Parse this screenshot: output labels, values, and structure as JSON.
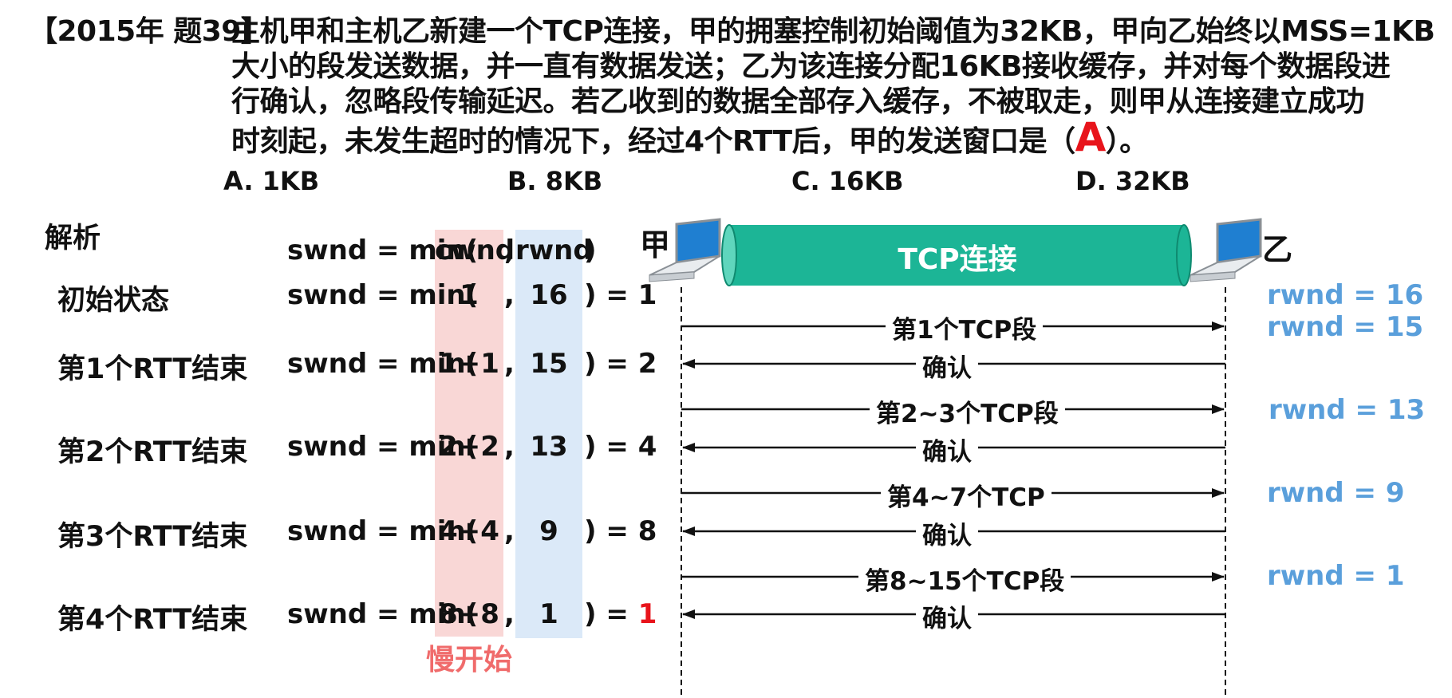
{
  "question": {
    "tag": "【2015年 题39】",
    "lines": [
      "主机甲和主机乙新建一个TCP连接，甲的拥塞控制初始阈值为32KB，甲向乙始终以MSS=1KB",
      "大小的段发送数据，并一直有数据发送；乙为该连接分配16KB接收缓存，并对每个数据段进",
      "行确认，忽略段传输延迟。若乙收到的数据全部存入缓存，不被取走，则甲从连接建立成功",
      "时刻起，未发生超时的情况下，经过4个RTT后，甲的发送窗口是（"
    ],
    "answer": "A",
    "tail": "）。"
  },
  "options": [
    "A. 1KB",
    "B. 8KB",
    "C. 16KB",
    "D. 32KB"
  ],
  "analysis": {
    "title": "解析",
    "formula": {
      "prefix": "swnd = min(",
      "cwnd": "cwnd",
      "comma": ",",
      "rwnd": "rwnd",
      "suffix": ")"
    },
    "rows": [
      {
        "label": "初始状态",
        "prefix": "swnd = min(",
        "cwnd": "1",
        "comma": ",",
        "rwnd": "16",
        "result_text": ") = ",
        "result": "1"
      },
      {
        "label": "第1个RTT结束",
        "prefix": "swnd = min(",
        "cwnd": "1+1",
        "comma": ",",
        "rwnd": "15",
        "result_text": ") = ",
        "result": "2"
      },
      {
        "label": "第2个RTT结束",
        "prefix": "swnd = min(",
        "cwnd": "2+2",
        "comma": ",",
        "rwnd": "13",
        "result_text": ") = ",
        "result": "4"
      },
      {
        "label": "第3个RTT结束",
        "prefix": "swnd = min(",
        "cwnd": "4+4",
        "comma": ",",
        "rwnd": "9",
        "result_text": ") = ",
        "result": "8"
      },
      {
        "label": "第4个RTT结束",
        "prefix": "swnd = min(",
        "cwnd": "8+8",
        "comma": ",",
        "rwnd": "1",
        "result_text": ") = ",
        "result": "1"
      }
    ],
    "slow_start": "慢开始"
  },
  "diagram": {
    "sender": "甲",
    "receiver": "乙",
    "connection": "TCP连接",
    "messages": [
      "第1个TCP段",
      "确认",
      "第2~3个TCP段",
      "确认",
      "第4~7个TCP",
      "确认",
      "第8~15个TCP段",
      "确认"
    ],
    "rwnd_labels": [
      "rwnd = 16",
      "rwnd = 15",
      "rwnd = 13",
      "rwnd = 9",
      "rwnd = 1"
    ]
  },
  "colors": {
    "answer": "#e8141b",
    "tube": "#1cb596",
    "rwnd": "#5a9fdb",
    "cwnd_column": "#f9d7d6",
    "rwnd_column": "#dbe9f8",
    "slow_start": "#f06b6b"
  }
}
